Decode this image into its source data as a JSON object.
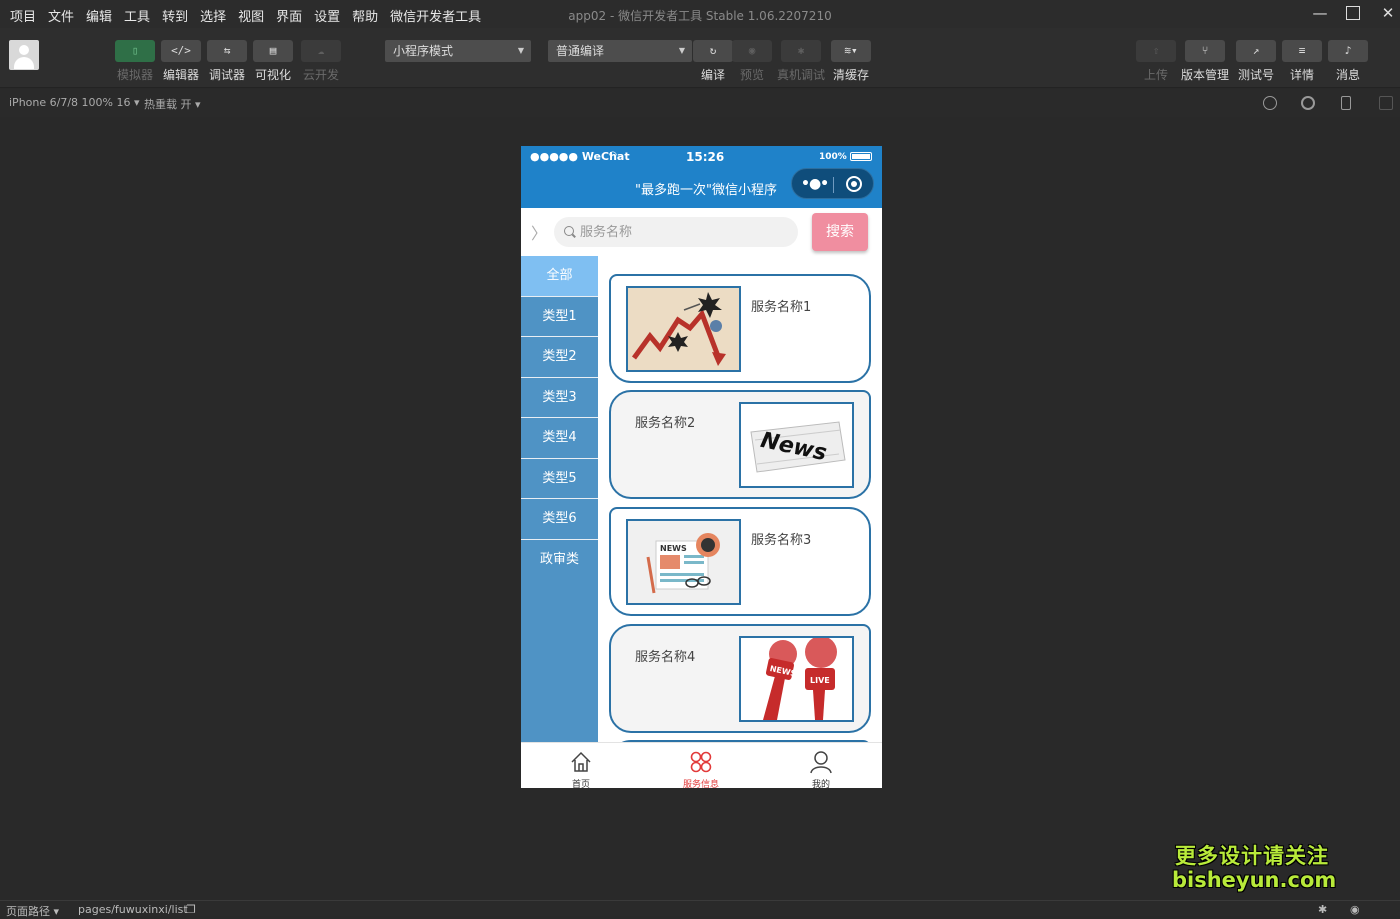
{
  "menubar": {
    "items": [
      "项目",
      "文件",
      "编辑",
      "工具",
      "转到",
      "选择",
      "视图",
      "界面",
      "设置",
      "帮助",
      "微信开发者工具"
    ],
    "window_title": "app02 - 微信开发者工具 Stable 1.06.2207210"
  },
  "toolbar": {
    "simulator": "模拟器",
    "editor": "编辑器",
    "debugger": "调试器",
    "visual": "可视化",
    "cloud": "云开发",
    "mode_select": "小程序模式",
    "compile_select": "普通编译",
    "compile": "编译",
    "preview": "预览",
    "remote_debug": "真机调试",
    "clear_cache": "清缓存",
    "upload": "上传",
    "version": "版本管理",
    "test": "测试号",
    "details": "详情",
    "messages": "消息"
  },
  "subbar": {
    "device": "iPhone 6/7/8 100% 16 ▾",
    "hot_reload": "热重载 开 ▾"
  },
  "phone": {
    "status": {
      "carrier": "●●●●● WeChat",
      "time": "15:26",
      "battery": "100%"
    },
    "nav_title": "\"最多跑一次\"微信小程序",
    "search": {
      "placeholder": "服务名称",
      "button": "搜索"
    },
    "categories": [
      "全部",
      "类型1",
      "类型2",
      "类型3",
      "类型4",
      "类型5",
      "类型6",
      "政审类"
    ],
    "cards": [
      {
        "name": "服务名称1",
        "image": "chart-crash-illustration"
      },
      {
        "name": "服务名称2",
        "image": "news-newspaper"
      },
      {
        "name": "服务名称3",
        "image": "news-coffee-glasses"
      },
      {
        "name": "服务名称4",
        "image": "news-live-microphones"
      }
    ],
    "tabs": [
      {
        "label": "首页",
        "icon": "home-icon"
      },
      {
        "label": "服务信息",
        "icon": "service-icon",
        "active": true
      },
      {
        "label": "我的",
        "icon": "user-icon"
      }
    ]
  },
  "statusbar": {
    "page_path_label": "页面路径 ▾",
    "page_path": "pages/fuwuxinxi/list"
  },
  "watermark": {
    "line1": "更多设计请关注",
    "line2": "bisheyun.com"
  },
  "colors": {
    "nav_blue": "#1f82c9",
    "sidebar_blue": "#4f93c5",
    "active_cat": "#7fbff2",
    "search_btn": "#f08ea0",
    "tab_active": "#e23a3a"
  }
}
